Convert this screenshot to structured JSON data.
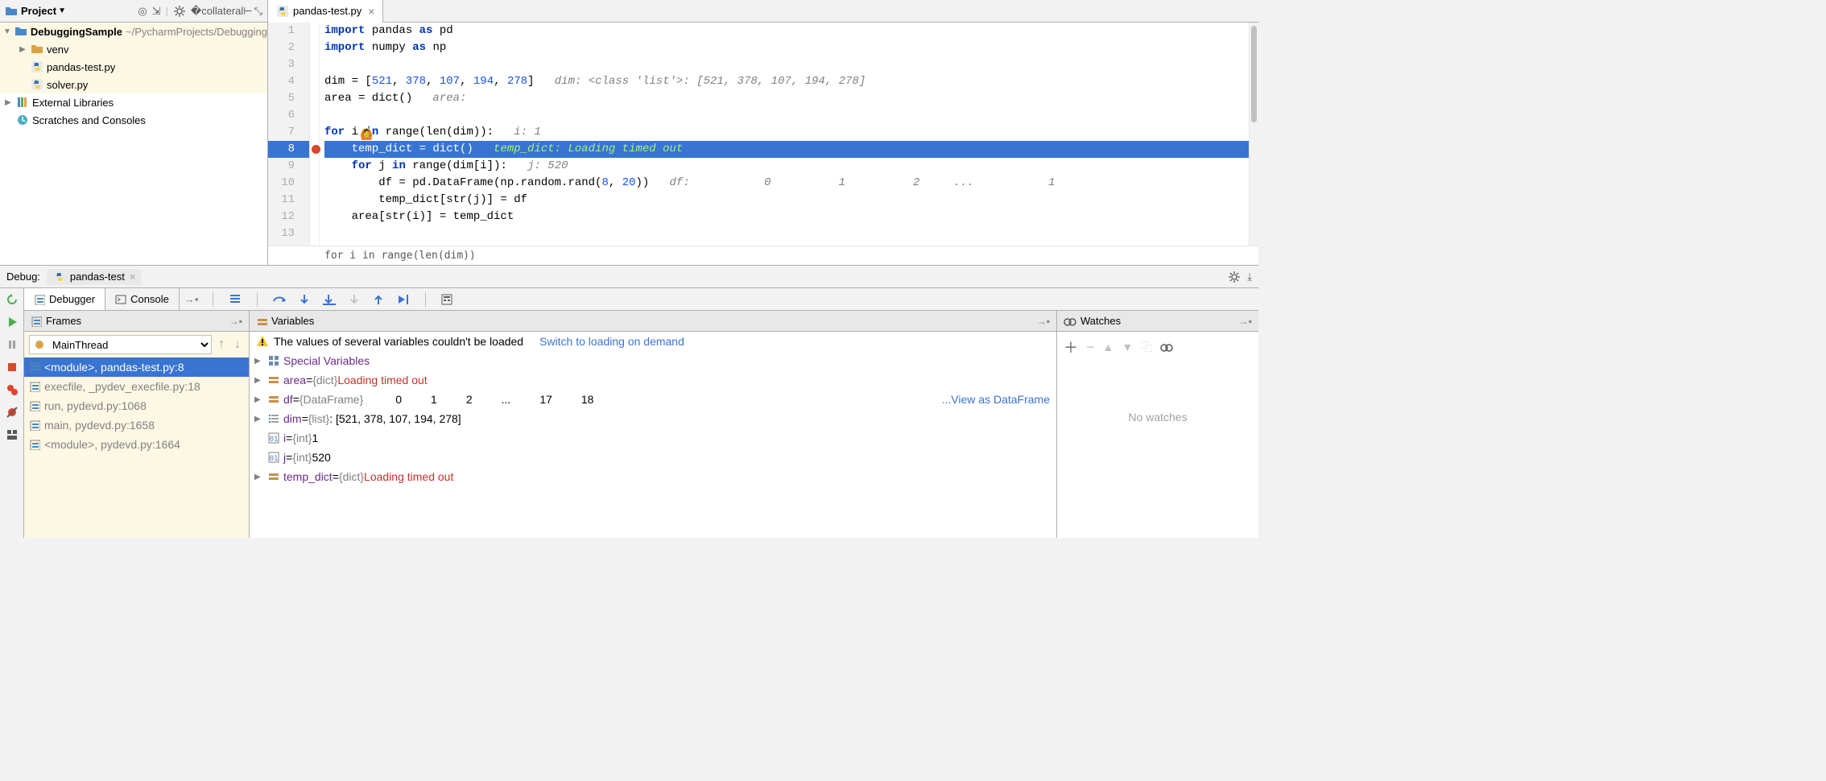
{
  "project": {
    "panel_title": "Project",
    "root_name": "DebuggingSample",
    "root_path": "~/PycharmProjects/DebuggingSa",
    "items": [
      {
        "kind": "dir",
        "name": "venv",
        "depth": 1,
        "expander": "▶"
      },
      {
        "kind": "py",
        "name": "pandas-test.py",
        "depth": 1
      },
      {
        "kind": "py",
        "name": "solver.py",
        "depth": 1
      }
    ],
    "external": "External Libraries",
    "scratches": "Scratches and Consoles"
  },
  "editor": {
    "tab_label": "pandas-test.py",
    "lines": [
      {
        "n": 1,
        "html": "<span class='kw'>import</span> pandas <span class='kw'>as</span> pd"
      },
      {
        "n": 2,
        "html": "<span class='kw'>import</span> numpy <span class='kw'>as</span> np"
      },
      {
        "n": 3,
        "html": ""
      },
      {
        "n": 4,
        "html": "dim = [<span class='num'>521</span>, <span class='num'>378</span>, <span class='num'>107</span>, <span class='num'>194</span>, <span class='num'>278</span>]   <span class='cm'>dim: &lt;class 'list'&gt;: [521, 378, 107, 194, 278]</span>"
      },
      {
        "n": 5,
        "html": "area = dict()   <span class='cm'>area:</span>"
      },
      {
        "n": 6,
        "html": ""
      },
      {
        "n": 7,
        "html": "<span style='position:relative'><span class='face'>🙆</span></span><span class='kw'>for</span> i <span class='kw'>in</span> range(len(dim)):   <span class='cm'>i: 1</span>"
      },
      {
        "n": 8,
        "highlight": true,
        "bp": true,
        "html": "    temp_dict = dict()   <span class='cm2'>temp_dict: Loading timed out</span>"
      },
      {
        "n": 9,
        "html": "    <span class='kw'>for</span> j <span class='kw'>in</span> range(dim[i]):   <span class='cm'>j: 520</span>"
      },
      {
        "n": 10,
        "html": "        df = pd.DataFrame(np.random.rand(<span class='num'>8</span>, <span class='num'>20</span>))   <span class='cm'>df:           0          1          2     ...           1</span>"
      },
      {
        "n": 11,
        "html": "        temp_dict[str(j)] = df"
      },
      {
        "n": 12,
        "html": "    area[str(i)] = temp_dict"
      },
      {
        "n": 13,
        "html": ""
      }
    ],
    "breadcrumb": "for i in range(len(dim))"
  },
  "debug": {
    "label": "Debug:",
    "run_config": "pandas-test",
    "tabs": {
      "debugger": "Debugger",
      "console": "Console"
    },
    "panels": {
      "frames": "Frames",
      "variables": "Variables",
      "watches": "Watches"
    },
    "thread": "MainThread",
    "frames": [
      {
        "label": "<module>, pandas-test.py:8",
        "sel": true
      },
      {
        "label": "execfile, _pydev_execfile.py:18"
      },
      {
        "label": "run, pydevd.py:1068"
      },
      {
        "label": "main, pydevd.py:1658"
      },
      {
        "label": "<module>, pydevd.py:1664"
      }
    ],
    "warn_msg": "The values of several variables couldn't be loaded",
    "warn_link": "Switch to loading on demand",
    "variables": [
      {
        "exp": "▶",
        "icon": "grid",
        "name": "Special Variables",
        "type": "",
        "value": ""
      },
      {
        "exp": "▶",
        "icon": "obj",
        "name": "area",
        "eq": " = ",
        "type": "{dict}",
        "err": "Loading timed out"
      },
      {
        "exp": "▶",
        "icon": "obj",
        "name": "df",
        "eq": " = ",
        "type": "{DataFrame}",
        "cols": [
          "0",
          "1",
          "2",
          "...",
          "17",
          "18"
        ],
        "link": "...View as DataFrame"
      },
      {
        "exp": "▶",
        "icon": "list",
        "name": "dim",
        "eq": " = ",
        "type": "{list}",
        "value": " <class 'list'>: [521, 378, 107, 194, 278]"
      },
      {
        "exp": "",
        "icon": "int",
        "name": "i",
        "eq": " = ",
        "type": "{int}",
        "value": " 1"
      },
      {
        "exp": "",
        "icon": "int",
        "name": "j",
        "eq": " = ",
        "type": "{int}",
        "value": " 520"
      },
      {
        "exp": "▶",
        "icon": "obj",
        "name": "temp_dict",
        "eq": " = ",
        "type": "{dict}",
        "err": "Loading timed out"
      }
    ],
    "watches_empty": "No watches"
  }
}
